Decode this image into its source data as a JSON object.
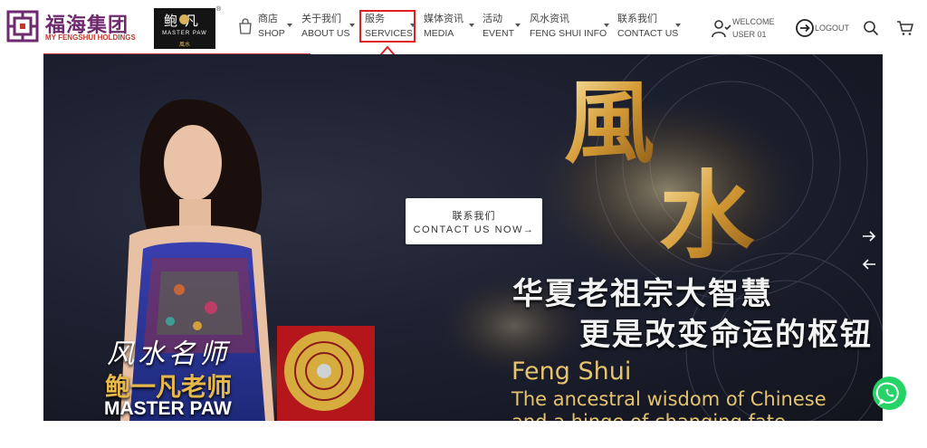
{
  "brand": {
    "logo_cn": "福海集团",
    "logo_en": "MY FENGSHUI HOLDINGS",
    "master_logo_cn": "鲍凡",
    "master_logo_en": "MASTER PAW",
    "master_logo_sub": "風水"
  },
  "nav": [
    {
      "cn": "商店",
      "en": "SHOP"
    },
    {
      "cn": "关于我们",
      "en": "ABOUT US"
    },
    {
      "cn": "服务",
      "en": "SERVICES"
    },
    {
      "cn": "媒体资讯",
      "en": "MEDIA"
    },
    {
      "cn": "活动",
      "en": "EVENT"
    },
    {
      "cn": "风水资讯",
      "en": "FENG SHUI INFO"
    },
    {
      "cn": "联系我们",
      "en": "CONTACT US"
    }
  ],
  "user": {
    "welcome": "WELCOME",
    "name": "USER 01",
    "logout": "LOGOUT"
  },
  "hero": {
    "cta_cn": "联系我们",
    "cta_en": "CONTACT US NOW→",
    "fengshui_cn": "風水",
    "slogan_line1": "华夏老祖宗大智慧",
    "slogan_line2": "更是改变命运的枢钮",
    "title_en": "Feng Shui",
    "sub_line1": "The ancestral wisdom of Chinese",
    "sub_line2": "and a hinge of changing fate",
    "master_title_cn": "风水名师",
    "master_name_cn": "鲍一凡老师",
    "master_name_en": "MASTER PAW"
  },
  "icons": {
    "shop": "shopping-bag-icon",
    "user": "user-check-icon",
    "logout": "logout-arrow-icon",
    "search": "search-icon",
    "cart": "cart-icon",
    "next": "arrow-right-icon",
    "prev": "arrow-left-icon",
    "whatsapp": "whatsapp-icon"
  },
  "colors": {
    "brand_purple": "#6d2a6e",
    "brand_red": "#c0392b",
    "highlight": "#e02020",
    "gold": "#e6c46e",
    "whatsapp": "#25d366"
  }
}
